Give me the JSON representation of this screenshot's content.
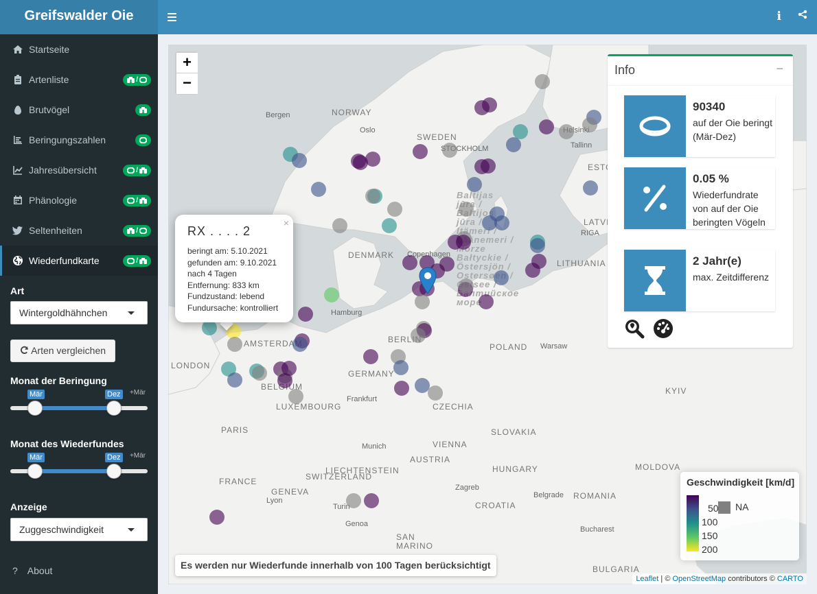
{
  "app": {
    "title": "Greifswalder Oie"
  },
  "header": {
    "toggle_icon": "hamburger-icon",
    "info_label": "i",
    "share_icon": "share-icon"
  },
  "sidebar": {
    "items": [
      {
        "label": "Startseite",
        "icon": "home-icon",
        "badge": ""
      },
      {
        "label": "Artenliste",
        "icon": "clipboard-icon",
        "badge": "binoculars / ring"
      },
      {
        "label": "Brutvögel",
        "icon": "egg-icon",
        "badge": "binoculars"
      },
      {
        "label": "Beringungszahlen",
        "icon": "bar-chart-icon",
        "badge": "ring"
      },
      {
        "label": "Jahresübersicht",
        "icon": "line-chart-icon",
        "badge": "ring / binoculars"
      },
      {
        "label": "Phänologie",
        "icon": "calendar-icon",
        "badge": "ring / binoculars"
      },
      {
        "label": "Seltenheiten",
        "icon": "twitter-bird-icon",
        "badge": "binoculars / ring"
      },
      {
        "label": "Wiederfundkarte",
        "icon": "globe-icon",
        "badge": "ring / binoculars",
        "active": true
      }
    ],
    "badge_separator": "/",
    "species": {
      "label": "Art",
      "value": "Wintergoldhähnchen"
    },
    "compare_button": "Arten vergleichen",
    "ringing_month": {
      "label": "Monat der Beringung",
      "from": "Mär",
      "to": "Dez",
      "max": "+Mär"
    },
    "recovery_month": {
      "label": "Monat des Wiederfundes",
      "from": "Mär",
      "to": "Dez",
      "max": "+Mär"
    },
    "display": {
      "label": "Anzeige",
      "value": "Zuggeschwindigkeit"
    },
    "about": {
      "label": "About",
      "icon": "question-icon"
    }
  },
  "map": {
    "zoom_in": "+",
    "zoom_out": "−",
    "labels": {
      "norway": "NORWAY",
      "sweden": "SWEDEN",
      "denmark": "DENMARK",
      "germany": "GERMANY",
      "belgium": "BELGIUM",
      "luxembourg": "LUXEMBOURG",
      "france": "FRANCE",
      "switzerland": "SWITZERLAND",
      "liechtenstein": "LIECHTENSTEIN",
      "austria": "AUSTRIA",
      "czechia": "CZECHIA",
      "poland": "POLAND",
      "lithuania": "LITHUANIA",
      "latvia": "LATVIA",
      "estonia": "ESTONIA",
      "slovakia": "SLOVAKIA",
      "hungary": "HUNGARY",
      "romania": "ROMANIA",
      "croatia": "CROATIA",
      "moldova": "MOLDOVA",
      "bulgaria": "BULGARIA",
      "san_marino": "SAN\nMARINO",
      "london": "LONDON",
      "paris": "PARIS",
      "amsterdam": "AMSTERDAM",
      "berlin": "BERLIN",
      "hamburg": "Hamburg",
      "frankfurt": "Frankfurt",
      "munich": "Munich",
      "vienna": "VIENNA",
      "warsaw": "Warsaw",
      "kyiv": "KYIV",
      "oslo": "Oslo",
      "stockholm": "STOCKHOLM",
      "bergen": "Bergen",
      "helsinki": "Helsinki",
      "tallinn": "Tallinn",
      "riga": "RIGA",
      "copenhagen": "Copenhagen",
      "geneva": "GENEVA",
      "lyon": "Lyon",
      "turin": "Turin",
      "genoa": "Genoa",
      "zagreb": "Zagreb",
      "belgrade": "Belgrade",
      "bucharest": "Bucharest",
      "baltic_sea": "Baltijas\njūra /\nBaltijos\njūra /\nItämeri /\nLäänemeri /\nMorze\nBałtyckie /\nÖstersjön /\nOstersøen /\nOstsee /\nБалтийское\nморе"
    },
    "popup": {
      "title": "RX . . . . 2",
      "lines": [
        "beringt am: 5.10.2021",
        "gefunden am: 9.10.2021",
        "nach 4 Tagen",
        "Entfernung: 833 km",
        "Fundzustand: lebend",
        "Fundursache: kontrolliert"
      ],
      "close": "×"
    },
    "info": {
      "title": "Info",
      "collapse": "−",
      "stats": [
        {
          "value": "90340",
          "text": "auf der Oie beringt (Mär-Dez)",
          "icon": "ring-icon"
        },
        {
          "value": "0.05 %",
          "text": "Wiederfundrate von auf der Oie beringten Vögeln",
          "icon": "percent-icon"
        },
        {
          "value": "2 Jahr(e)",
          "text": "max. Zeitdifferenz",
          "icon": "hourglass-icon"
        }
      ],
      "tools": [
        "search-location-icon",
        "tachometer-icon"
      ]
    },
    "legend": {
      "title": "Geschwindigkeit [km/d]",
      "ticks": [
        "50",
        "100",
        "150",
        "200"
      ],
      "na": "NA",
      "colors": [
        "#440154",
        "#3b528b",
        "#21908d",
        "#5dc863",
        "#fde725"
      ],
      "na_color": "#808080"
    },
    "note": "Es werden nur Wiederfunde innerhalb von 100 Tagen berücksichtigt",
    "attribution": {
      "leaflet": "Leaflet",
      "sep1": " | © ",
      "osm": "OpenStreetMap",
      "mid": " contributors © ",
      "carto": "CARTO"
    }
  }
}
